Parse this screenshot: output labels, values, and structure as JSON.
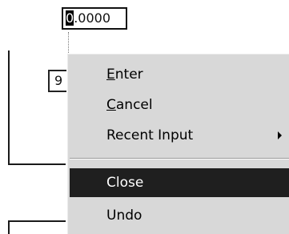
{
  "dynamic_input": {
    "value_selected_char": "0",
    "value_rest": ".0000"
  },
  "tooltip_box": {
    "text": "9"
  },
  "context_menu": {
    "items": [
      {
        "label_prefix": "",
        "accel": "E",
        "label_suffix": "nter"
      },
      {
        "label_prefix": "",
        "accel": "C",
        "label_suffix": "ancel"
      },
      {
        "label": "Recent Input",
        "submenu_icon": "chevron-right-icon"
      },
      {
        "label": "Close",
        "highlighted": true
      },
      {
        "label": "Undo"
      }
    ]
  },
  "colors": {
    "menu_bg": "#d8d8d8",
    "highlight_bg": "#1f1f1f",
    "highlight_text": "#ffffff"
  }
}
